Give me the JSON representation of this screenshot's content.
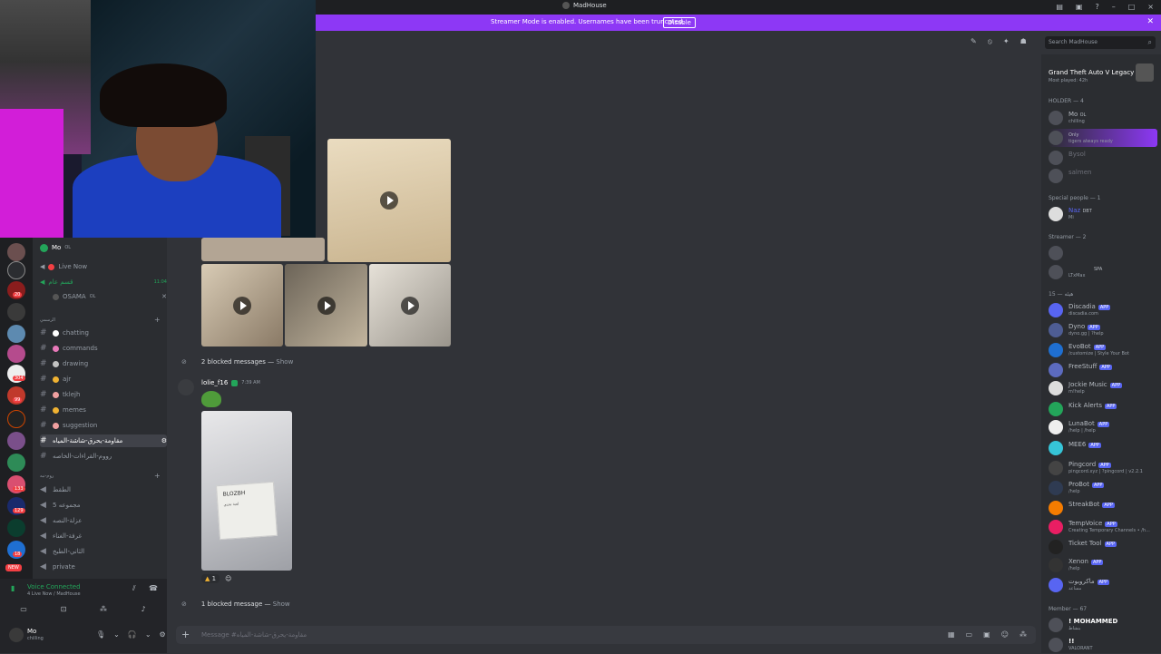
{
  "window": {
    "title": "MadHouse"
  },
  "banner": {
    "message": "Streamer Mode is enabled. Usernames have been truncated.",
    "button": "Disable"
  },
  "search": {
    "placeholder": "Search MadHouse"
  },
  "voice_top": {
    "name": "Mo",
    "tag": "OL"
  },
  "channels_top": [
    {
      "label": "Live Now",
      "icon": "speaker-icon"
    },
    {
      "label": "قسم عام",
      "time": "11:04"
    },
    {
      "label": "OSAMA",
      "tag": "OL"
    }
  ],
  "category1": "الرسمي",
  "channels": [
    {
      "label": "chatting",
      "emoji_color": "#ffffff"
    },
    {
      "label": "commands",
      "emoji_color": "#e879b9"
    },
    {
      "label": "drawing",
      "emoji_color": "#c2c2c2"
    },
    {
      "label": "ajr",
      "emoji_color": "#f0b232"
    },
    {
      "label": "tklejh",
      "emoji_color": "#f0a0a0"
    },
    {
      "label": "memes",
      "emoji_color": "#f0b232"
    },
    {
      "label": "suggestion",
      "emoji_color": "#f0a0a0"
    },
    {
      "label": "مقاومة-يحرق-شاشة-المياه",
      "emoji_color": "#949ba4"
    },
    {
      "label": "رووم-القراءات-الخاصه",
      "emoji_color": "#949ba4"
    }
  ],
  "category2": "روم-نبه",
  "voice_channels": [
    {
      "label": "الطقط"
    },
    {
      "label": "مجموعه 5"
    },
    {
      "label": "عزلة-النصه"
    },
    {
      "label": "غرفة-الغناء"
    },
    {
      "label": "الثاني-الطبخ"
    },
    {
      "label": "private"
    }
  ],
  "voicebar": {
    "status": "Voice Connected",
    "sub": "4 Live Now / MadHouse"
  },
  "userbar": {
    "name": "Mo",
    "status": "chilling"
  },
  "rail": {
    "badges": [
      "20",
      "304",
      "99",
      "133",
      "129",
      "18"
    ],
    "new": "NEW"
  },
  "messages": {
    "blocked1": "2 blocked messages — ",
    "blocked2": "1 blocked message — ",
    "show": "Show",
    "author": "lolie_f16",
    "time": "7:39 AM",
    "photo_text": "BLOZBH",
    "photo_sub": "لعبة تحدي",
    "reaction_count": "1"
  },
  "composer": {
    "placeholder": "Message #مقاومة-يحرق-شاشة-المياه"
  },
  "activity": {
    "game": "Grand Theft Auto V Legacy",
    "played": "Most played: 42h"
  },
  "member_groups": [
    {
      "header": "HOLDER — 4"
    },
    {
      "header": "Special people — 1"
    },
    {
      "header": "Streamer — 2"
    },
    {
      "header": "هيئه — 15"
    },
    {
      "header": "Member — 67"
    }
  ],
  "holders": [
    {
      "name": "Mo",
      "status": "chilling",
      "tag": "OL"
    },
    {
      "name": "",
      "status": "tigers always ready",
      "tag": "Only"
    },
    {
      "name": "Bysol",
      "status": ""
    },
    {
      "name": "salmen",
      "status": ""
    }
  ],
  "special": [
    {
      "name": "Naz",
      "status": "Mi",
      "tag": "DBT"
    }
  ],
  "streamers": [
    {
      "name": "",
      "status": ""
    },
    {
      "name": "",
      "status": "LTxMax",
      "tag": "SPA"
    }
  ],
  "bots": [
    {
      "name": "Discadia",
      "status": "discadia.com"
    },
    {
      "name": "Dyno",
      "status": "dyno.gg | ?help"
    },
    {
      "name": "EvoBot",
      "status": "/customize | Style Your Bot"
    },
    {
      "name": "FreeStuff",
      "status": ""
    },
    {
      "name": "Jockie Music",
      "status": "m!help"
    },
    {
      "name": "Kick Alerts",
      "status": ""
    },
    {
      "name": "LunaBot",
      "status": "/help | /help"
    },
    {
      "name": "MEE6",
      "status": ""
    },
    {
      "name": "Pingcord",
      "status": "pingcord.xyz | ?pingcord | v2.2.1"
    },
    {
      "name": "ProBot",
      "status": "/help"
    },
    {
      "name": "StreakBot",
      "status": ""
    },
    {
      "name": "TempVoice",
      "status": "Creating Temporary Channels • /h..."
    },
    {
      "name": "Ticket Tool",
      "status": ""
    },
    {
      "name": "Xenon",
      "status": "/help"
    },
    {
      "name": "ماكروبوت",
      "status": "مساعد"
    }
  ],
  "members_list": [
    {
      "name": "! MOHAMMED",
      "status": "بنشاط"
    },
    {
      "name": "!!",
      "status": "VALORANT"
    }
  ],
  "app_label": "APP",
  "colors": {
    "accent": "#8d38f5",
    "bg": "#313338",
    "sidebar": "#2b2d31"
  }
}
